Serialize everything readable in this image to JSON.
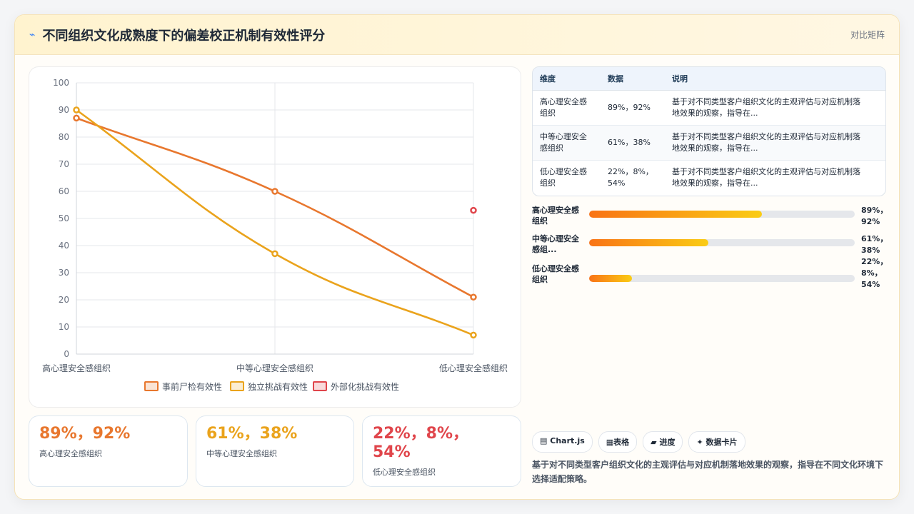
{
  "header": {
    "title": "不同组织文化成熟度下的偏差校正机制有效性评分",
    "badge": "对比矩阵"
  },
  "chart_data": {
    "type": "line",
    "categories": [
      "高心理安全感组织",
      "中等心理安全感组织",
      "低心理安全感组织"
    ],
    "series": [
      {
        "name": "事前尸检有效性",
        "values": [
          87,
          60,
          21
        ],
        "color": "#e8772e"
      },
      {
        "name": "独立挑战有效性",
        "values": [
          90,
          37,
          7
        ],
        "color": "#eaa31c"
      },
      {
        "name": "外部化挑战有效性",
        "values": [
          null,
          null,
          53
        ],
        "color": "#e0454b"
      }
    ],
    "ylim": [
      0,
      100
    ],
    "yticks": [
      0,
      10,
      20,
      30,
      40,
      50,
      60,
      70,
      80,
      90,
      100
    ],
    "grid": true,
    "legend": "bottom"
  },
  "stats": [
    {
      "value": "89%，92%",
      "label": "高心理安全感组织",
      "color": "#e8772e"
    },
    {
      "value": "61%，38%",
      "label": "中等心理安全感组织",
      "color": "#eaa31c"
    },
    {
      "value_line1": "22%，8%，",
      "value_line2": "54%",
      "label": "低心理安全感组织",
      "color": "#e0454b"
    }
  ],
  "table": {
    "headers": [
      "维度",
      "数据",
      "说明"
    ],
    "rows": [
      {
        "dim_line1": "高心理安全感",
        "dim_line2": "组织",
        "data_line1": "89%，92%",
        "data_line2": "",
        "desc_line1": "基于对不同类型客户组织文化的主观评估与对应机制落",
        "desc_line2": "地效果的观察，指导在..."
      },
      {
        "dim_line1": "中等心理安全",
        "dim_line2": "感组织",
        "data_line1": "61%，38%",
        "data_line2": "",
        "desc_line1": "基于对不同类型客户组织文化的主观评估与对应机制落",
        "desc_line2": "地效果的观察，指导在..."
      },
      {
        "dim_line1": "低心理安全感",
        "dim_line2": "组织",
        "data_line1": "22%，8%，",
        "data_line2": "54%",
        "desc_line1": "基于对不同类型客户组织文化的主观评估与对应机制落",
        "desc_line2": "地效果的观察，指导在..."
      }
    ]
  },
  "progress": [
    {
      "label_line1": "高心理安全感",
      "label_line2": "组织",
      "value_lines": [
        "89%，",
        "92%"
      ],
      "fill": 0.65
    },
    {
      "label_line1": "中等心理安全",
      "label_line2": "感组...",
      "value_lines": [
        "61%，",
        "38%"
      ],
      "fill": 0.45
    },
    {
      "label_line1": "低心理安全感",
      "label_line2": "组织",
      "value_lines": [
        "22%，",
        "8%，",
        "54%"
      ],
      "fill": 0.16
    }
  ],
  "chips": [
    "Chart.js",
    "表格",
    "进度",
    "数据卡片"
  ],
  "chip_icons": [
    "chart-icon",
    "table-icon",
    "progress-icon",
    "sparkle-icon"
  ],
  "description": "基于对不同类型客户组织文化的主观评估与对应机制落地效果的观察，指导在不同文化环境下选择适配策略。"
}
